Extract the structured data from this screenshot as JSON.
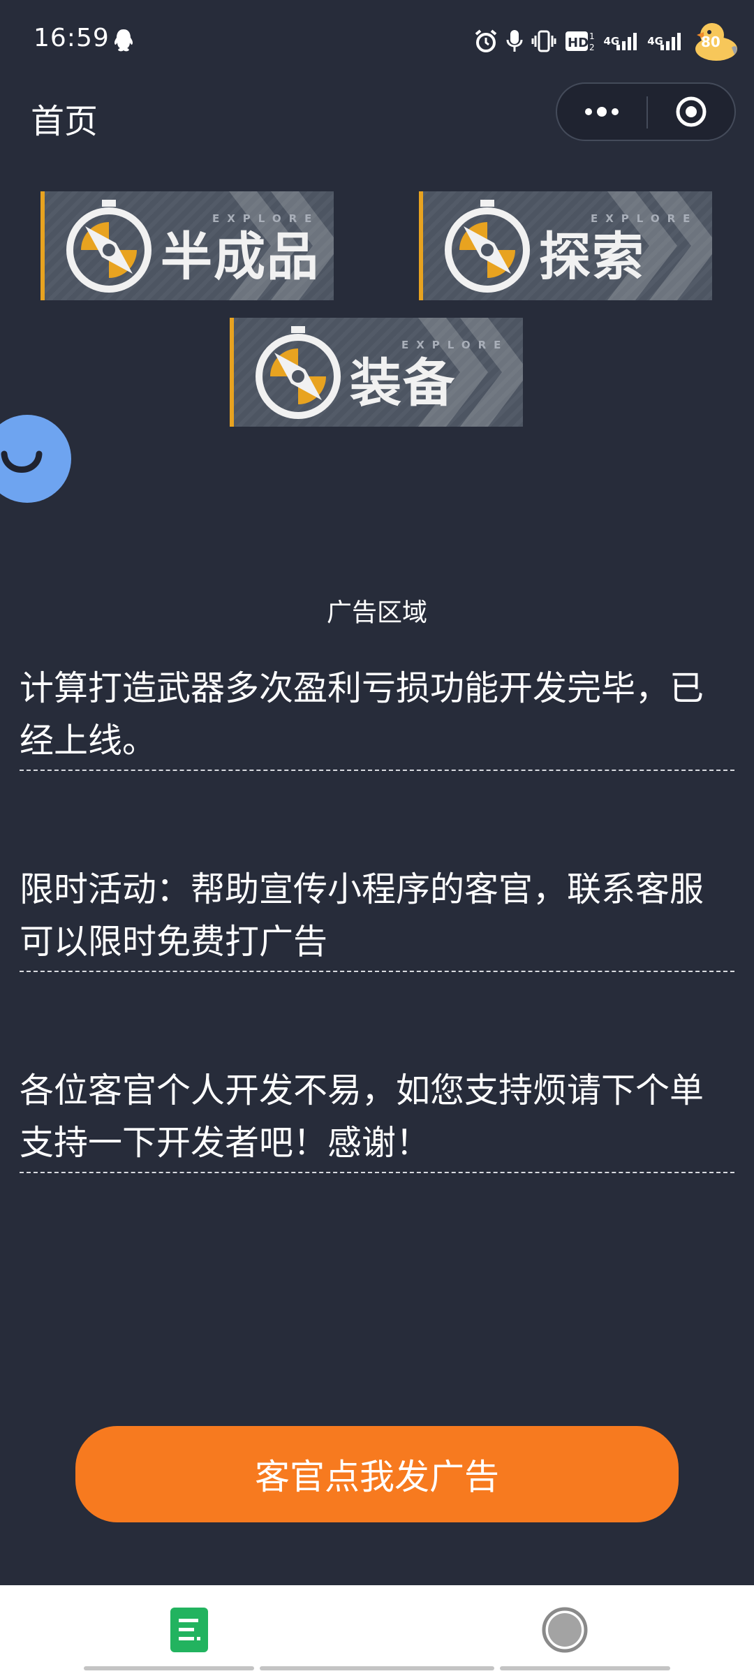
{
  "status_bar": {
    "time": "16:59",
    "network": [
      "4G",
      "4G"
    ],
    "hd_label": "HD",
    "battery": "80",
    "icons": [
      "qq-icon",
      "alarm-icon",
      "mic-icon",
      "vibrate-icon",
      "hd-icon",
      "signal-icon",
      "signal-icon",
      "battery-duck-icon"
    ]
  },
  "nav": {
    "title": "首页",
    "capsule_icons": [
      "more-icon",
      "close-target-icon"
    ]
  },
  "banners": [
    {
      "label": "半成品",
      "tag": "EXPLORE"
    },
    {
      "label": "探索",
      "tag": "EXPLORE"
    },
    {
      "label": "装备",
      "tag": "EXPLORE"
    }
  ],
  "ad_area": "广告区域",
  "notices": [
    "计算打造武器多次盈利亏损功能开发完毕，已经上线。",
    "限时活动：帮助宣传小程序的客官，联系客服可以限时免费打广告",
    "各位客官个人开发不易，如您支持烦请下个单支持一下开发者吧！感谢！"
  ],
  "cta": {
    "label": "客官点我发广告"
  },
  "tab_bar": {
    "icons": [
      "list-icon",
      "profile-icon"
    ]
  },
  "colors": {
    "background": "#272c3a",
    "accent_orange": "#f77a1f",
    "banner_stripe": "#e8a320",
    "tab_green": "#22b35f",
    "bubble_blue": "#6ea4f0"
  }
}
